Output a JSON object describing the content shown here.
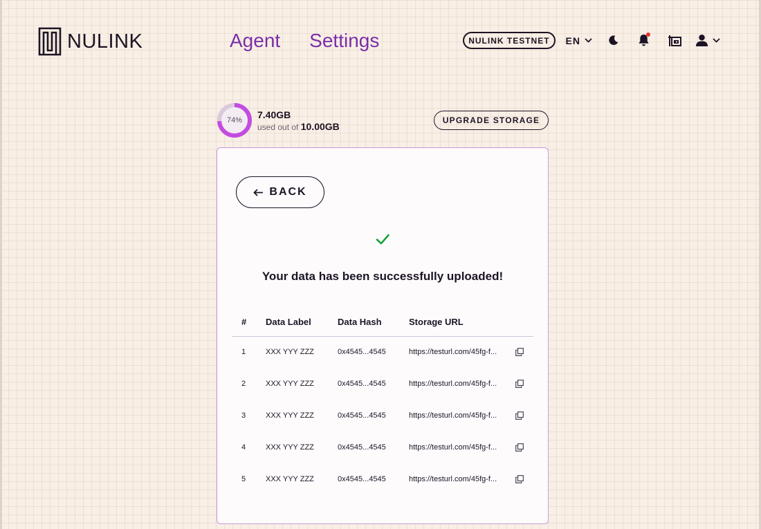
{
  "brand": {
    "name": "NULINK"
  },
  "nav": {
    "agent": "Agent",
    "settings": "Settings"
  },
  "header": {
    "network": "NULINK TESTNET",
    "language": "EN",
    "icons": [
      "moon-icon",
      "bell-icon",
      "wallet-icon",
      "user-icon"
    ],
    "notification_dot_color": "#e8322a"
  },
  "storage": {
    "percent_label": "74%",
    "percent": 74,
    "used": "7.40GB",
    "used_out_of": "used out of",
    "total": "10.00GB",
    "upgrade_label": "UPGRADE STORAGE",
    "ring_color": "#c34ce0"
  },
  "card": {
    "back_label": "BACK",
    "success_message": "Your data has been successfully uploaded!",
    "success_color": "#1aa33a"
  },
  "table": {
    "headers": [
      "#",
      "Data Label",
      "Data Hash",
      "Storage URL"
    ],
    "rows": [
      {
        "num": "1",
        "label": "XXX YYY ZZZ",
        "hash": "0x4545...4545",
        "url": "https://testurl.com/45fg-f..."
      },
      {
        "num": "2",
        "label": "XXX YYY ZZZ",
        "hash": "0x4545...4545",
        "url": "https://testurl.com/45fg-f..."
      },
      {
        "num": "3",
        "label": "XXX YYY ZZZ",
        "hash": "0x4545...4545",
        "url": "https://testurl.com/45fg-f..."
      },
      {
        "num": "4",
        "label": "XXX YYY ZZZ",
        "hash": "0x4545...4545",
        "url": "https://testurl.com/45fg-f..."
      },
      {
        "num": "5",
        "label": "XXX YYY ZZZ",
        "hash": "0x4545...4545",
        "url": "https://testurl.com/45fg-f..."
      }
    ]
  },
  "colors": {
    "accent": "#7a2ea8",
    "border": "#c79be0",
    "background": "#f8efe6"
  }
}
